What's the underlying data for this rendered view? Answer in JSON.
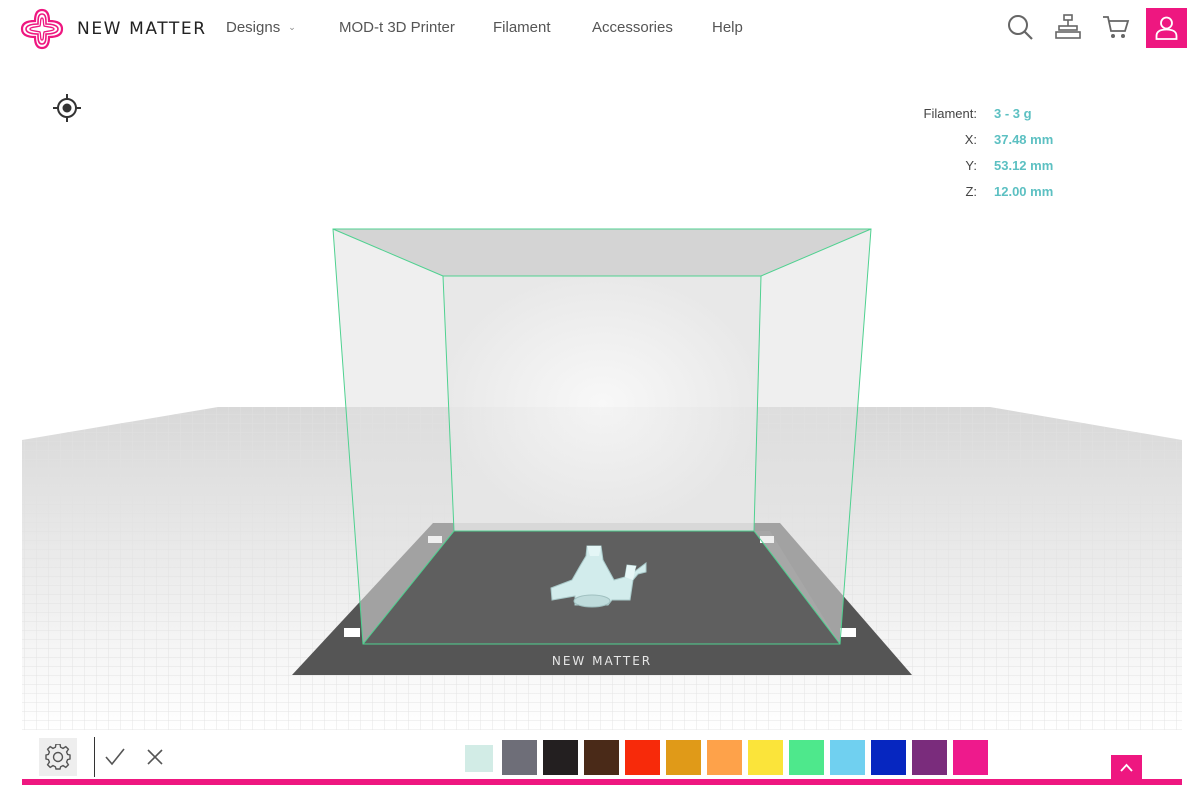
{
  "header": {
    "brand": "NEW MATTER",
    "nav": [
      {
        "label": "Designs",
        "has_dropdown": true
      },
      {
        "label": "MOD-t 3D Printer",
        "has_dropdown": false
      },
      {
        "label": "Filament",
        "has_dropdown": false
      },
      {
        "label": "Accessories",
        "has_dropdown": false
      },
      {
        "label": "Help",
        "has_dropdown": false
      }
    ],
    "icons": [
      "search-icon",
      "printer-icon",
      "cart-icon",
      "user-icon"
    ],
    "accent_color": "#ee1780"
  },
  "viewer": {
    "stats": [
      {
        "label": "Filament:",
        "value": "3 - 3 g"
      },
      {
        "label": "X:",
        "value": "37.48 mm"
      },
      {
        "label": "Y:",
        "value": "53.12 mm"
      },
      {
        "label": "Z:",
        "value": "12.00 mm"
      }
    ],
    "bed_label": "NEW MATTER",
    "model_color": "#d2ecec",
    "bed_color": "#555555",
    "frame_color": "#4fd190"
  },
  "toolbar": {
    "icons": [
      "settings-icon",
      "check-icon",
      "close-icon",
      "arrow-up-icon"
    ],
    "swatches": [
      {
        "color": "#d2ece6",
        "selected": true
      },
      {
        "color": "#6e6e78",
        "selected": false
      },
      {
        "color": "#231f20",
        "selected": false
      },
      {
        "color": "#4a2a18",
        "selected": false
      },
      {
        "color": "#f72a0a",
        "selected": false
      },
      {
        "color": "#e09a18",
        "selected": false
      },
      {
        "color": "#fea24a",
        "selected": false
      },
      {
        "color": "#fbe43a",
        "selected": false
      },
      {
        "color": "#4ee88c",
        "selected": false
      },
      {
        "color": "#70d0f0",
        "selected": false
      },
      {
        "color": "#0626c0",
        "selected": false
      },
      {
        "color": "#7a2c7c",
        "selected": false
      },
      {
        "color": "#ee1a8c",
        "selected": false
      }
    ]
  }
}
